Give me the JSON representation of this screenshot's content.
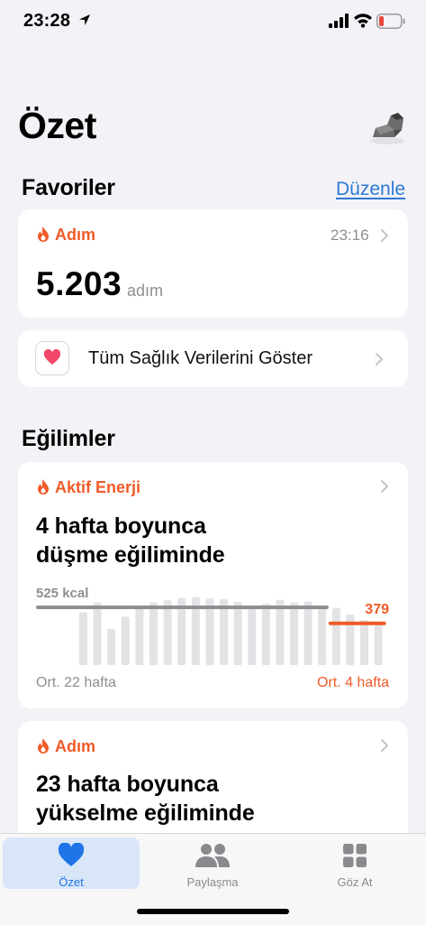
{
  "status_bar": {
    "time": "23:28",
    "battery_color": "#e5473f"
  },
  "header": {
    "title": "Özet"
  },
  "favorites": {
    "title": "Favoriler",
    "edit_label": "Düzenle",
    "steps_card": {
      "category": "Adım",
      "time": "23:16",
      "value": "5.203",
      "unit": "adım"
    },
    "all_data_label": "Tüm Sağlık Verilerini Göster"
  },
  "trends": {
    "title": "Eğilimler",
    "energy_card": {
      "category": "Aktif Enerji",
      "headline_1": "4 hafta boyunca",
      "headline_2": "düşme eğiliminde",
      "avg_22_label": "525 kcal",
      "avg_4_value": "379",
      "footer_left": "Ort. 22 hafta",
      "footer_right": "Ort. 4 hafta"
    },
    "steps_card": {
      "category": "Adım",
      "headline_1": "23 hafta boyunca",
      "headline_2": "yükselme eğiliminde"
    }
  },
  "tabbar": {
    "tabs": [
      {
        "label": "Özet",
        "icon": "heart-icon",
        "active": true
      },
      {
        "label": "Paylaşma",
        "icon": "people-icon",
        "active": false
      },
      {
        "label": "Göz At",
        "icon": "grid-icon",
        "active": false
      }
    ]
  },
  "colors": {
    "accent_orange": "#f05a28",
    "link_blue": "#2c7ad6",
    "tab_active": "#1f74e8"
  },
  "chart_data": {
    "type": "bar",
    "unit": "kcal",
    "values": [
      480,
      570,
      330,
      440,
      530,
      570,
      590,
      610,
      620,
      605,
      600,
      575,
      540,
      560,
      595,
      570,
      580,
      530,
      520,
      460,
      410,
      390
    ],
    "average_22_weeks": 525,
    "average_4_weeks": 379,
    "highlight_last": 4,
    "ylim": [
      0,
      640
    ],
    "colors": {
      "bars": "#e3e3e6",
      "avg22_line": "#8e8e93",
      "avg4_line": "#f05a28"
    }
  }
}
